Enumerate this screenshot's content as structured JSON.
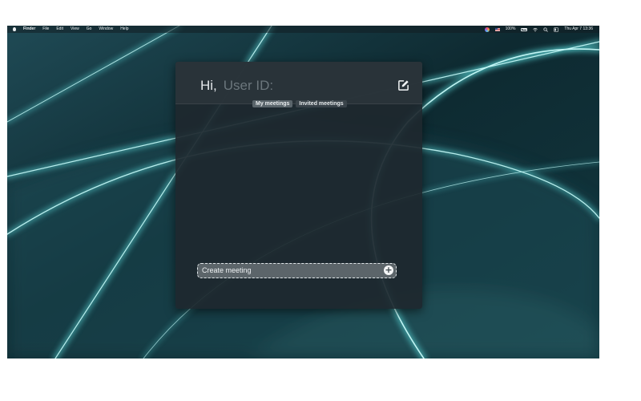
{
  "menubar": {
    "app_name": "Finder",
    "menus": [
      "File",
      "Edit",
      "View",
      "Go",
      "Window",
      "Help"
    ],
    "battery": "100%",
    "datetime": "Thu Apr 7  13:36"
  },
  "app": {
    "greeting": "Hi,",
    "user_placeholder": "User ID:",
    "tabs": [
      {
        "label": "My meetings",
        "active": true
      },
      {
        "label": "Invited meetings",
        "active": false
      }
    ],
    "create_meeting_label": "Create meeting",
    "plus_glyph": "+"
  },
  "icons": {
    "edit": "edit-icon",
    "add": "plus-circle-icon",
    "apple": "apple-logo-icon",
    "wifi": "wifi-icon",
    "search": "search-icon",
    "control_center": "control-center-icon",
    "siri": "siri-icon",
    "flag": "us-flag-icon",
    "battery": "battery-icon"
  },
  "colors": {
    "wallpaper_glow": "#5ee7e8",
    "wallpaper_dark": "#0b1e24",
    "window_bg": "#1e282e",
    "button_bg": "#5c656a"
  }
}
